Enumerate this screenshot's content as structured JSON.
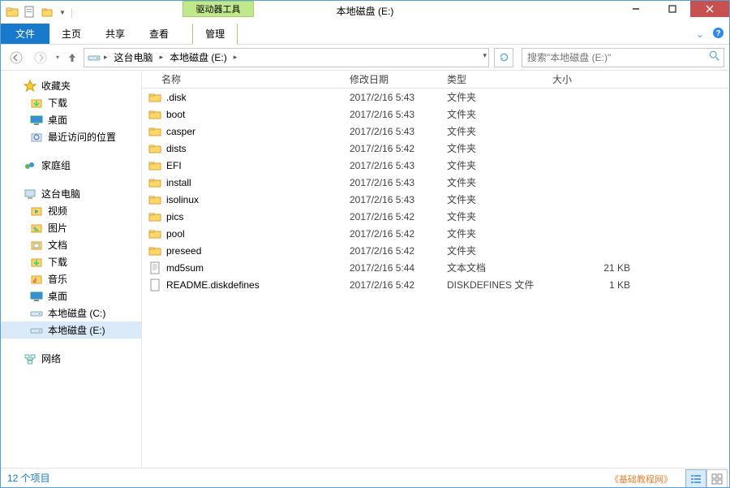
{
  "window_title": "本地磁盘 (E:)",
  "qat": {
    "drive_tools": "驱动器工具"
  },
  "ribbon": {
    "file": "文件",
    "home": "主页",
    "share": "共享",
    "view": "查看",
    "manage": "管理"
  },
  "nav": {
    "computer": "这台电脑",
    "location": "本地磁盘 (E:)",
    "search_placeholder": "搜索\"本地磁盘 (E:)\""
  },
  "tree": {
    "favorites": "收藏夹",
    "downloads": "下载",
    "desktop": "桌面",
    "recent": "最近访问的位置",
    "homegroup": "家庭组",
    "computer": "这台电脑",
    "videos": "视频",
    "pictures": "图片",
    "documents": "文档",
    "downloads2": "下载",
    "music": "音乐",
    "desktop2": "桌面",
    "drive_c": "本地磁盘 (C:)",
    "drive_e": "本地磁盘 (E:)",
    "network": "网络"
  },
  "columns": {
    "name": "名称",
    "date": "修改日期",
    "type": "类型",
    "size": "大小"
  },
  "files": [
    {
      "name": ".disk",
      "date": "2017/2/16 5:43",
      "type": "文件夹",
      "size": "",
      "icon": "folder"
    },
    {
      "name": "boot",
      "date": "2017/2/16 5:43",
      "type": "文件夹",
      "size": "",
      "icon": "folder"
    },
    {
      "name": "casper",
      "date": "2017/2/16 5:43",
      "type": "文件夹",
      "size": "",
      "icon": "folder"
    },
    {
      "name": "dists",
      "date": "2017/2/16 5:42",
      "type": "文件夹",
      "size": "",
      "icon": "folder"
    },
    {
      "name": "EFI",
      "date": "2017/2/16 5:43",
      "type": "文件夹",
      "size": "",
      "icon": "folder"
    },
    {
      "name": "install",
      "date": "2017/2/16 5:43",
      "type": "文件夹",
      "size": "",
      "icon": "folder"
    },
    {
      "name": "isolinux",
      "date": "2017/2/16 5:43",
      "type": "文件夹",
      "size": "",
      "icon": "folder"
    },
    {
      "name": "pics",
      "date": "2017/2/16 5:42",
      "type": "文件夹",
      "size": "",
      "icon": "folder"
    },
    {
      "name": "pool",
      "date": "2017/2/16 5:42",
      "type": "文件夹",
      "size": "",
      "icon": "folder"
    },
    {
      "name": "preseed",
      "date": "2017/2/16 5:42",
      "type": "文件夹",
      "size": "",
      "icon": "folder"
    },
    {
      "name": "md5sum",
      "date": "2017/2/16 5:44",
      "type": "文本文档",
      "size": "21 KB",
      "icon": "text"
    },
    {
      "name": "README.diskdefines",
      "date": "2017/2/16 5:42",
      "type": "DISKDEFINES 文件",
      "size": "1 KB",
      "icon": "file"
    }
  ],
  "status": {
    "count": "12 个项目"
  },
  "watermark": "《基础教程网》"
}
